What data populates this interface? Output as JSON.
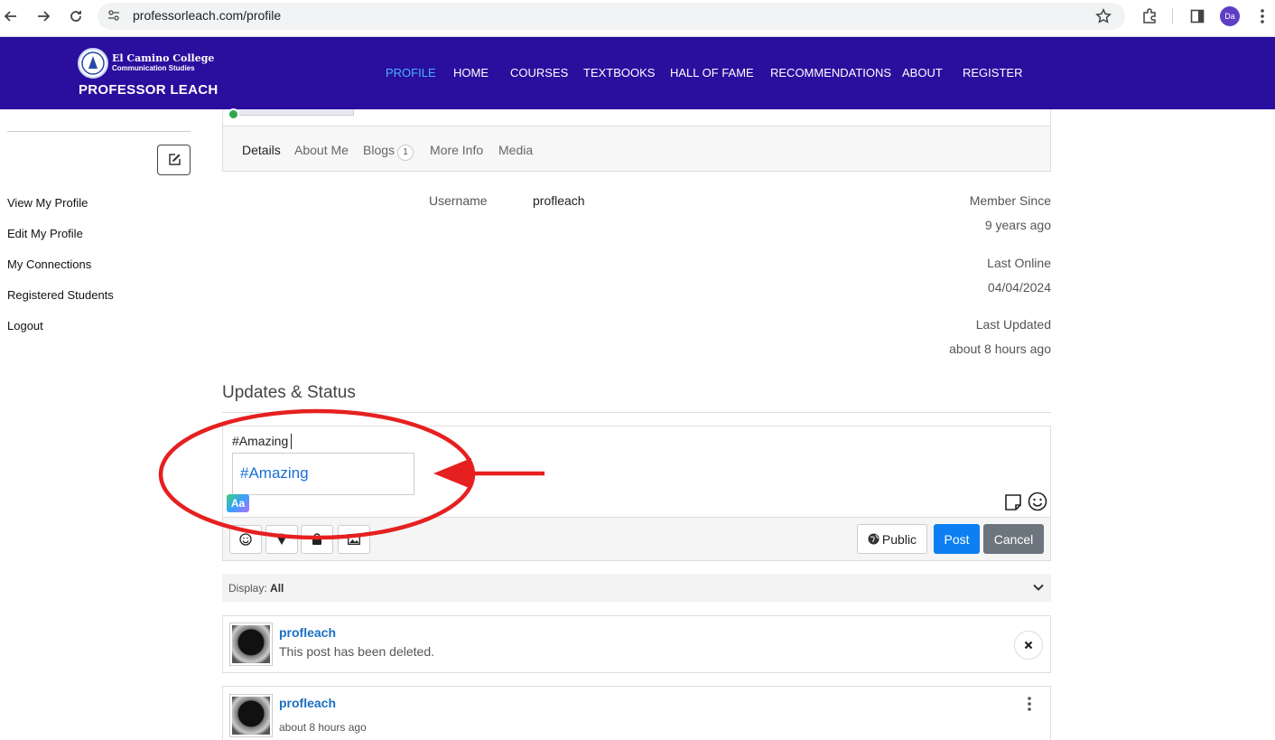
{
  "browser": {
    "url": "professorleach.com/profile",
    "avatar_initials": "Da"
  },
  "site": {
    "logo_line1": "El Camino College",
    "logo_line2": "Communication Studies",
    "logo_line3": "PROFESSOR LEACH",
    "nav": [
      "PROFILE",
      "HOME",
      "COURSES",
      "TEXTBOOKS",
      "HALL OF FAME",
      "RECOMMENDATIONS",
      "ABOUT",
      "REGISTER"
    ],
    "active_nav": "PROFILE"
  },
  "sidebar": {
    "links": [
      "View My Profile",
      "Edit My Profile",
      "My Connections",
      "Registered Students",
      "Logout"
    ]
  },
  "profile": {
    "tabs": [
      "Details",
      "About Me",
      "Blogs",
      "More Info",
      "Media"
    ],
    "blogs_count": "1",
    "username_label": "Username",
    "username_value": "profleach",
    "member_since_label": "Member Since",
    "member_since_value": "9 years ago",
    "last_online_label": "Last Online",
    "last_online_value": "04/04/2024",
    "last_updated_label": "Last Updated",
    "last_updated_value": "about 8 hours ago"
  },
  "updates": {
    "title": "Updates & Status",
    "composer_text": "#Amazing",
    "suggestion": "#Amazing",
    "aa_label": "Aa",
    "public_label": "Public",
    "post_label": "Post",
    "cancel_label": "Cancel",
    "display_label": "Display:",
    "display_value": "All"
  },
  "posts": [
    {
      "author": "profleach",
      "text": "This post has been deleted."
    },
    {
      "author": "profleach",
      "text": "about 8 hours ago"
    }
  ],
  "colors": {
    "header_bg": "#2a0e9e",
    "nav_active": "#45b2ff",
    "link_blue": "#1a6fc4",
    "post_btn": "#0d7ff2",
    "annotation_red": "#e62020"
  }
}
